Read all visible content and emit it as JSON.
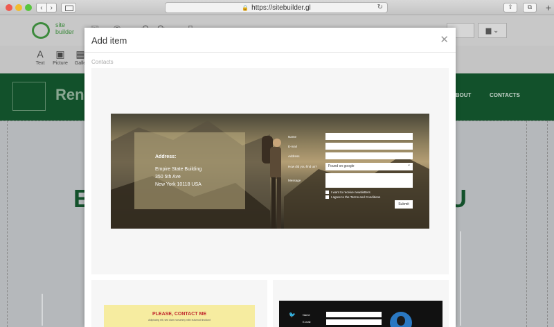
{
  "browser": {
    "url": "https://sitebuilder.gl",
    "back_icon": "chevron-left-icon",
    "forward_icon": "chevron-right-icon",
    "reload_icon": "reload-icon"
  },
  "app": {
    "logo_text_line1": "site",
    "logo_text_line2": "builder",
    "blocks": [
      {
        "label": "Text",
        "icon": "A"
      },
      {
        "label": "Picture",
        "icon": "▣"
      },
      {
        "label": "Galle",
        "icon": "▦"
      }
    ]
  },
  "site": {
    "brand": "Ren",
    "nav": [
      "ABOUT",
      "CONTACTS"
    ],
    "hero_left": "E",
    "hero_right": "U"
  },
  "modal": {
    "title": "Add item",
    "section": "Contacts",
    "card1": {
      "address_title": "Address:",
      "address_lines": [
        "Empire State Building",
        "350 5th Ave",
        "New York 10118 USA"
      ],
      "labels": {
        "name": "Name",
        "email": "E-mail",
        "address": "Address",
        "find": "How did you find us?",
        "message": "Message"
      },
      "select_value": "Found on google",
      "checkbox_newsletter": "I want to receive newsletters",
      "checkbox_terms": "I agree to the Terms and Conditions",
      "submit": "Submit"
    },
    "card2": {
      "title": "PLEASE, CONTACT ME",
      "subtitle": "Adipiscing elit, sed diam nonummy nibh euismod tincidunt"
    },
    "card3": {
      "label_name": "Name",
      "label_email": "E-mail"
    }
  },
  "colors": {
    "site_header": "#12512b",
    "accent_green": "#3d8a3d"
  }
}
